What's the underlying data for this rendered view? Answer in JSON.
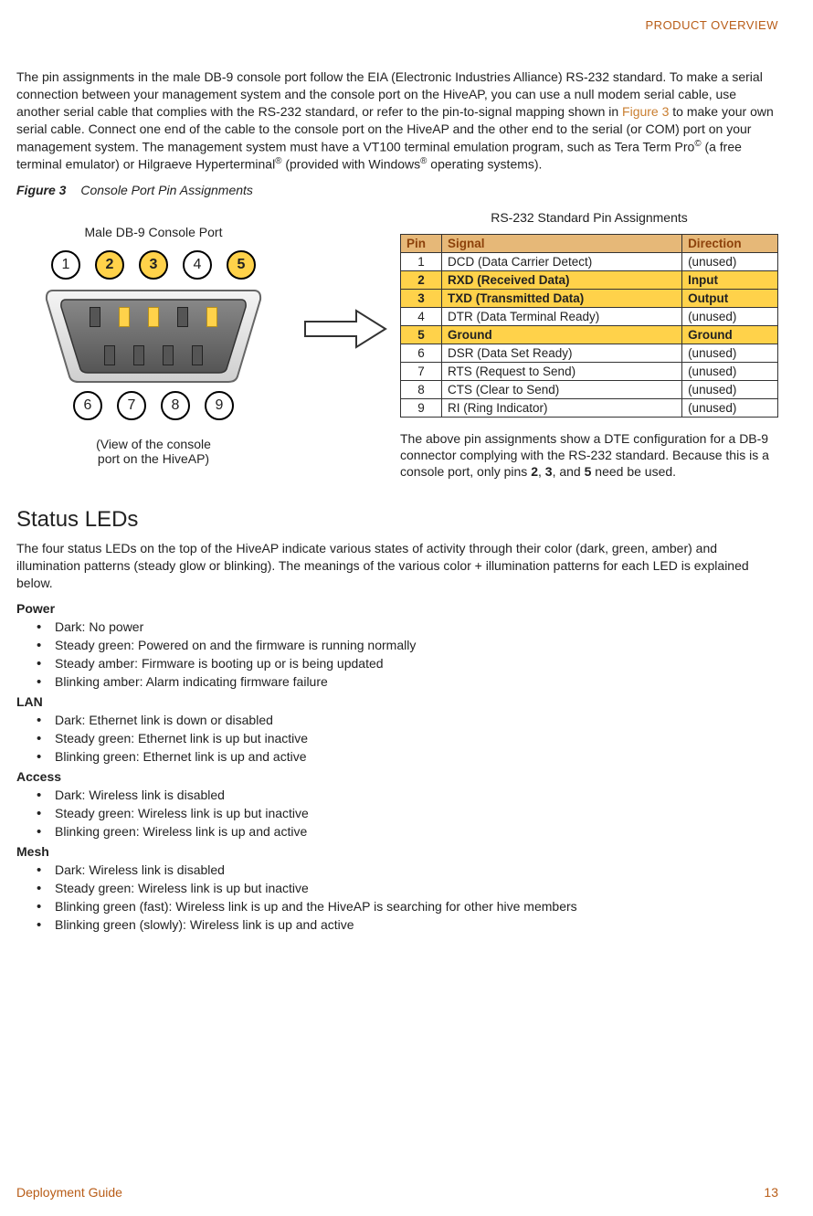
{
  "running_head": "PRODUCT OVERVIEW",
  "intro_paragraph": "The pin assignments in the male DB-9 console port follow the EIA (Electronic Industries Alliance) RS-232 standard. To make a serial connection between your management system and the console port on the HiveAP, you can use a null modem serial cable, use another serial cable that complies with the RS-232 standard, or refer to the pin-to-signal mapping shown in ",
  "intro_xref": "Figure 3",
  "intro_after_xref": " to make your own serial cable. Connect one end of the cable to the console port on the HiveAP and the other end to the serial (or COM) port on your management system. The management system must have a VT100 terminal emulation program, such as Tera Term Pro",
  "intro_sup1": "©",
  "intro_mid": " (a free terminal emulator) or Hilgraeve Hyperterminal",
  "intro_sup2": "®",
  "intro_mid2": " (provided with Windows",
  "intro_sup3": "®",
  "intro_end": " operating systems).",
  "figure_num": "Figure 3",
  "figure_title": "Console Port Pin Assignments",
  "connector_label": "Male DB-9 Console Port",
  "connector_note_l1": "(View of the console",
  "connector_note_l2": "port on the HiveAP)",
  "pins_top": [
    "1",
    "2",
    "3",
    "4",
    "5"
  ],
  "pins_bottom": [
    "6",
    "7",
    "8",
    "9"
  ],
  "highlighted_pins": [
    "2",
    "3",
    "5"
  ],
  "chart_data": {
    "type": "table",
    "title": "RS-232 Standard Pin Assignments",
    "columns": [
      "Pin",
      "Signal",
      "Direction"
    ],
    "rows": [
      {
        "pin": "1",
        "signal": "DCD (Data Carrier Detect)",
        "direction": "(unused)",
        "highlight": false
      },
      {
        "pin": "2",
        "signal": "RXD (Received Data)",
        "direction": "Input",
        "highlight": true
      },
      {
        "pin": "3",
        "signal": "TXD (Transmitted Data)",
        "direction": "Output",
        "highlight": true
      },
      {
        "pin": "4",
        "signal": "DTR (Data Terminal Ready)",
        "direction": "(unused)",
        "highlight": false
      },
      {
        "pin": "5",
        "signal": "Ground",
        "direction": "Ground",
        "highlight": true
      },
      {
        "pin": "6",
        "signal": "DSR (Data Set Ready)",
        "direction": "(unused)",
        "highlight": false
      },
      {
        "pin": "7",
        "signal": "RTS (Request to Send)",
        "direction": "(unused)",
        "highlight": false
      },
      {
        "pin": "8",
        "signal": "CTS (Clear to Send)",
        "direction": "(unused)",
        "highlight": false
      },
      {
        "pin": "9",
        "signal": "RI (Ring Indicator)",
        "direction": "(unused)",
        "highlight": false
      }
    ]
  },
  "table_note_pre": "The above pin assignments show a DTE configuration for a DB-9 connector complying with the RS-232 standard. Because this is a console port, only pins ",
  "table_note_b1": "2",
  "table_note_sep1": ", ",
  "table_note_b2": "3",
  "table_note_sep2": ", and ",
  "table_note_b3": "5",
  "table_note_post": " need be used.",
  "section2_title": "Status LEDs",
  "section2_body": "The four status LEDs on the top of the HiveAP indicate various states of activity through their color (dark, green, amber) and illumination patterns (steady glow or blinking). The meanings of the various color + illumination patterns for each LED is explained below.",
  "led_groups": [
    {
      "title": "Power",
      "items": [
        "Dark: No power",
        "Steady green: Powered on and the firmware is running normally",
        "Steady amber: Firmware is booting up or is being updated",
        "Blinking amber: Alarm indicating firmware failure"
      ]
    },
    {
      "title": "LAN",
      "items": [
        "Dark: Ethernet link is down or disabled",
        "Steady green: Ethernet link is up but inactive",
        "Blinking green: Ethernet link is up and active"
      ]
    },
    {
      "title": "Access",
      "items": [
        "Dark: Wireless link is disabled",
        "Steady green: Wireless link is up but inactive",
        "Blinking green: Wireless link is up and active"
      ]
    },
    {
      "title": "Mesh",
      "items": [
        "Dark: Wireless link is disabled",
        "Steady green: Wireless link is up but inactive",
        "Blinking green (fast): Wireless link is up and the HiveAP is searching for other hive members",
        "Blinking green (slowly): Wireless link is up and active"
      ]
    }
  ],
  "footer_left": "Deployment Guide",
  "footer_right": "13"
}
